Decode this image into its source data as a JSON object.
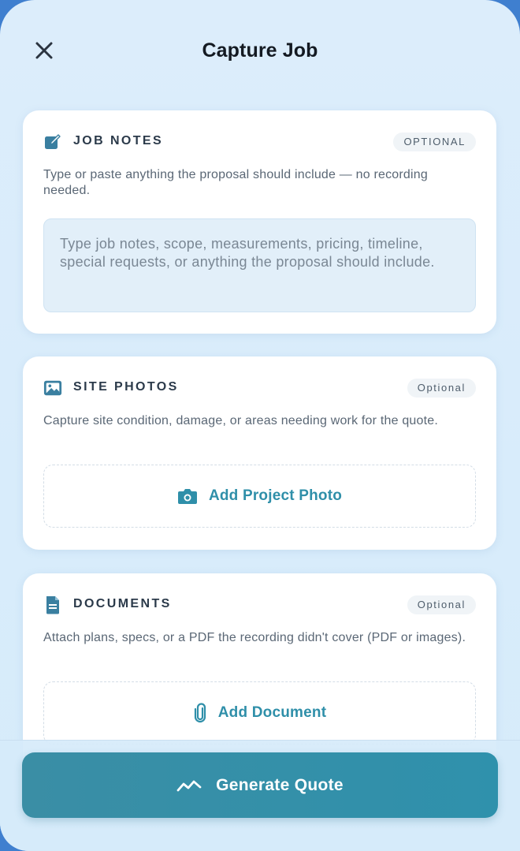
{
  "header": {
    "title": "Capture Job",
    "close_icon": "close-icon"
  },
  "job_notes": {
    "title": "JOB NOTES",
    "badge": "OPTIONAL",
    "description": "Type or paste anything the proposal should include — no recording needed.",
    "placeholder": "Type job notes, scope, measurements, pricing, timeline, special requests, or anything the proposal should include.",
    "icon": "edit-icon"
  },
  "site_photos": {
    "title": "SITE PHOTOS",
    "badge": "Optional",
    "description": "Capture site condition, damage, or areas needing work for the quote.",
    "button_label": "Add Project Photo",
    "icon": "image-icon",
    "button_icon": "camera-icon"
  },
  "documents": {
    "title": "DOCUMENTS",
    "badge": "Optional",
    "description": "Attach plans, specs, or a PDF the recording didn't cover (PDF or images).",
    "button_label": "Add Document",
    "icon": "document-icon",
    "button_icon": "paperclip-icon"
  },
  "footer": {
    "button_label": "Generate Quote",
    "button_icon": "trend-icon"
  },
  "colors": {
    "accent": "#2f8fa9",
    "button": "#3a8ea5",
    "background": "#dcedfb"
  }
}
